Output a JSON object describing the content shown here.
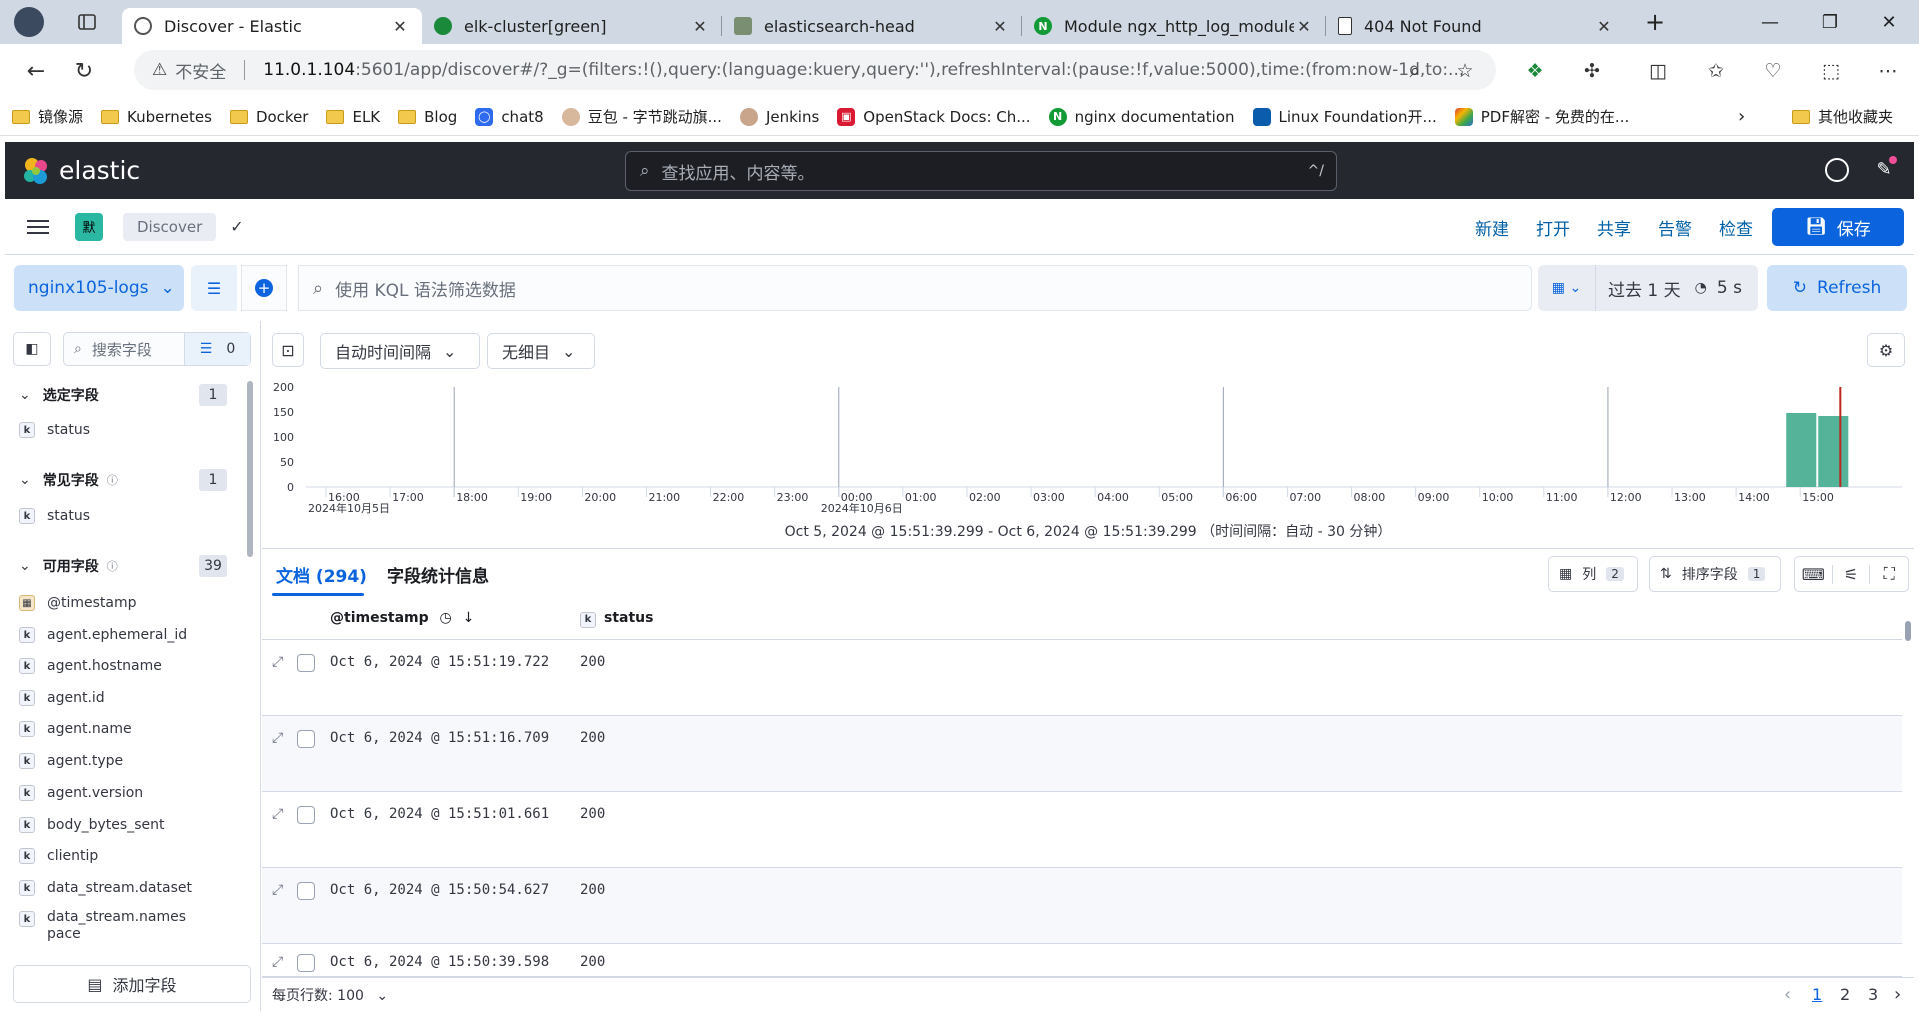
{
  "browser": {
    "tabs": [
      {
        "label": "Discover - Elastic",
        "active": true
      },
      {
        "label": "elk-cluster[green]"
      },
      {
        "label": "elasticsearch-head"
      },
      {
        "label": "Module ngx_http_log_module"
      },
      {
        "label": "404 Not Found"
      }
    ],
    "address": {
      "insecure_label": "不安全",
      "host": "11.0.1.104",
      "path": ":5601/app/discover#/?_g=(filters:!(),query:(language:kuery,query:''),refreshInterval:(pause:!f,value:5000),time:(from:now-1d,to:..."
    },
    "bookmarks": [
      {
        "label": "镜像源",
        "type": "folder"
      },
      {
        "label": "Kubernetes",
        "type": "folder"
      },
      {
        "label": "Docker",
        "type": "folder"
      },
      {
        "label": "ELK",
        "type": "folder"
      },
      {
        "label": "Blog",
        "type": "folder"
      },
      {
        "label": "chat8",
        "type": "site"
      },
      {
        "label": "豆包 - 字节跳动旗...",
        "type": "site"
      },
      {
        "label": "Jenkins",
        "type": "site"
      },
      {
        "label": "OpenStack Docs: Ch...",
        "type": "site"
      },
      {
        "label": "nginx documentation",
        "type": "site"
      },
      {
        "label": "Linux Foundation开...",
        "type": "site"
      },
      {
        "label": "PDF解密 - 免费的在...",
        "type": "site"
      }
    ],
    "other_bookmarks": "其他收藏夹"
  },
  "kibana": {
    "brand": "elastic",
    "search_placeholder": "查找应用、内容等。",
    "search_shortcut": "^/",
    "space_initial": "默",
    "breadcrumb": "Discover",
    "top_links": [
      "新建",
      "打开",
      "共享",
      "告警",
      "检查"
    ],
    "save_label": "保存"
  },
  "query": {
    "data_view": "nginx105-logs",
    "kql_placeholder": "使用 KQL 语法筛选数据",
    "time_range": "过去 1 天",
    "refresh_interval": "5 s",
    "refresh_label": "Refresh"
  },
  "sidebar": {
    "search_placeholder": "搜索字段",
    "filter_count": "0",
    "sections": [
      {
        "label": "选定字段",
        "count": "1",
        "fields": [
          {
            "type": "k",
            "name": "status"
          }
        ]
      },
      {
        "label": "常见字段",
        "count": "1",
        "fields": [
          {
            "type": "k",
            "name": "status"
          }
        ]
      },
      {
        "label": "可用字段",
        "count": "39",
        "fields": [
          {
            "type": "date",
            "name": "@timestamp"
          },
          {
            "type": "k",
            "name": "agent.ephemeral_id"
          },
          {
            "type": "k",
            "name": "agent.hostname"
          },
          {
            "type": "k",
            "name": "agent.id"
          },
          {
            "type": "k",
            "name": "agent.name"
          },
          {
            "type": "k",
            "name": "agent.type"
          },
          {
            "type": "k",
            "name": "agent.version"
          },
          {
            "type": "k",
            "name": "body_bytes_sent"
          },
          {
            "type": "k",
            "name": "clientip"
          },
          {
            "type": "k",
            "name": "data_stream.dataset"
          },
          {
            "type": "k",
            "name": "data_stream.names pace"
          }
        ]
      }
    ],
    "add_field_label": "添加字段"
  },
  "toolbar": {
    "interval_label": "自动时间间隔",
    "breakdown_label": "无细目"
  },
  "chart_data": {
    "type": "bar",
    "y_ticks": [
      "200",
      "150",
      "100",
      "50",
      "0"
    ],
    "ylim": [
      0,
      200
    ],
    "x_ticks": [
      "16:00",
      "17:00",
      "18:00",
      "19:00",
      "20:00",
      "21:00",
      "22:00",
      "23:00",
      "00:00",
      "01:00",
      "02:00",
      "03:00",
      "04:00",
      "05:00",
      "06:00",
      "07:00",
      "08:00",
      "09:00",
      "10:00",
      "11:00",
      "12:00",
      "13:00",
      "14:00",
      "15:00"
    ],
    "date_labels": [
      {
        "label": "2024年10月5日",
        "at": "16:00"
      },
      {
        "label": "2024年10月6日",
        "at": "00:00"
      }
    ],
    "bars": [
      {
        "x": "15:00",
        "value": 148
      },
      {
        "x": "15:30",
        "value": 142
      }
    ],
    "bar_color": "#54b399",
    "now_marker_color": "#bd271e"
  },
  "time_range_text": "Oct 5, 2024 @ 15:51:39.299 - Oct 6, 2024 @ 15:51:39.299 （时间间隔：自动 - 30 分钟）",
  "doc_tabs": {
    "documents": "文档 (294)",
    "field_stats": "字段统计信息"
  },
  "grid_controls": {
    "columns_label": "列",
    "columns_count": "2",
    "sort_label": "排序字段",
    "sort_count": "1"
  },
  "table": {
    "columns": [
      "@timestamp",
      "status"
    ],
    "rows": [
      {
        "timestamp": "Oct 6, 2024 @ 15:51:19.722",
        "status": "200"
      },
      {
        "timestamp": "Oct 6, 2024 @ 15:51:16.709",
        "status": "200"
      },
      {
        "timestamp": "Oct 6, 2024 @ 15:51:01.661",
        "status": "200"
      },
      {
        "timestamp": "Oct 6, 2024 @ 15:50:54.627",
        "status": "200"
      },
      {
        "timestamp": "Oct 6, 2024 @ 15:50:39.598",
        "status": "200"
      }
    ]
  },
  "footer": {
    "rows_per_page": "每页行数: 100",
    "pages": [
      "1",
      "2",
      "3"
    ]
  }
}
